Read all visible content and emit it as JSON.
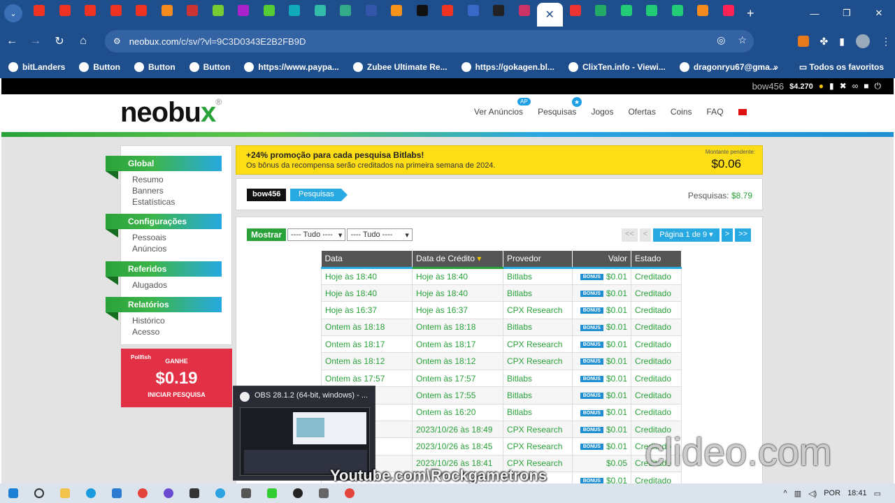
{
  "browser": {
    "tabs": [
      {
        "icon": "youtube-icon",
        "color": "#e32"
      },
      {
        "icon": "youtube-icon",
        "color": "#e32"
      },
      {
        "icon": "youtube-icon",
        "color": "#e32"
      },
      {
        "icon": "youtube-icon",
        "color": "#e32"
      },
      {
        "icon": "youtube-icon",
        "color": "#e32"
      },
      {
        "icon": "blogger-icon",
        "color": "#f58a1e"
      },
      {
        "icon": "app-icon",
        "color": "#c33"
      },
      {
        "icon": "vf-icon",
        "color": "#7c3"
      },
      {
        "icon": "app-icon",
        "color": "#a2c"
      },
      {
        "icon": "play-icon",
        "color": "#5c3"
      },
      {
        "icon": "c-icon",
        "color": "#1ab"
      },
      {
        "icon": "play-icon",
        "color": "#3ba"
      },
      {
        "icon": "globe-icon",
        "color": "#3a8"
      },
      {
        "icon": "c-icon",
        "color": "#35a"
      },
      {
        "icon": "bitcoin-icon",
        "color": "#f7931a"
      },
      {
        "icon": "tiktok-icon",
        "color": "#111"
      },
      {
        "icon": "youtube-icon",
        "color": "#e32"
      },
      {
        "icon": "download-icon",
        "color": "#3869c8"
      },
      {
        "icon": "r-icon",
        "color": "#222"
      },
      {
        "icon": "gear-icon",
        "color": "#c36"
      },
      {
        "icon": "close-icon",
        "color": "#fff",
        "active": true
      },
      {
        "icon": "app-icon",
        "color": "#e33"
      },
      {
        "icon": "app-icon",
        "color": "#2a6"
      },
      {
        "icon": "puzzle-icon",
        "color": "#2c7"
      },
      {
        "icon": "puzzle-icon",
        "color": "#2c7"
      },
      {
        "icon": "puzzle-icon",
        "color": "#2c7"
      },
      {
        "icon": "blogger-icon",
        "color": "#f58a1e"
      },
      {
        "icon": "blogger-icon",
        "color": "#f25"
      }
    ],
    "url_host": "neobux.com",
    "url_path": "/c/sv/?vl=9C3D0343E2B2FB9D",
    "bookmarks": [
      "bitLanders",
      "Button",
      "Button",
      "Button",
      "https://www.paypa...",
      "Zubee Ultimate Re...",
      "https://gokagen.bl...",
      "ClixTen.info - Viewi...",
      "dragonryu67@gma..."
    ],
    "bookmarks_more": "»",
    "all_bookmarks": "Todos os favoritos"
  },
  "site": {
    "user": "bow456",
    "balance": "$4.270",
    "logo_text": "neobu",
    "logo_x": "x",
    "logo_mark": "®",
    "nav": [
      {
        "label": "Ver Anúncios",
        "badge": "AP"
      },
      {
        "label": "Pesquisas",
        "badge": "★"
      },
      {
        "label": "Jogos"
      },
      {
        "label": "Ofertas"
      },
      {
        "label": "Coins"
      },
      {
        "label": "FAQ"
      }
    ]
  },
  "sidebar": {
    "sections": [
      {
        "title": "Global",
        "items": [
          "Resumo",
          "Banners",
          "Estatísticas"
        ]
      },
      {
        "title": "Configurações",
        "items": [
          "Pessoais",
          "Anúncios"
        ]
      },
      {
        "title": "Referidos",
        "items": [
          "Alugados"
        ]
      },
      {
        "title": "Relatórios",
        "items": [
          "Histórico",
          "Acesso"
        ]
      }
    ]
  },
  "pollfish": {
    "logo": "Pollfish",
    "earn": "GANHE",
    "amount": "$0.19",
    "cta": "INICIAR PESQUISA"
  },
  "promo": {
    "title": "+24% promoção para cada pesquisa Bitlabs!",
    "subtitle": "Os bônus da recompensa serão creditados na primeira semana de 2024.",
    "pending_label": "Montante pendente:",
    "pending_value": "$0.06"
  },
  "breadcrumb": {
    "user": "bow456",
    "page": "Pesquisas",
    "stat_label": "Pesquisas:",
    "stat_value": "$8.79"
  },
  "filters": {
    "show": "Mostrar",
    "filter1": "---- Tudo ----",
    "filter2": "---- Tudo ----"
  },
  "pager": {
    "first": "<<",
    "prev": "<",
    "page": "Página 1 de 9",
    "next": ">",
    "last": ">>"
  },
  "table": {
    "headers": [
      "Data",
      "Data de Crédito",
      "Provedor",
      "Valor",
      "Estado"
    ],
    "sort_indicator": "▾",
    "bonus_label": "BONUS",
    "rows": [
      {
        "date": "Hoje às 18:40",
        "credit": "Hoje às 18:40",
        "provider": "Bitlabs",
        "bonus": true,
        "value": "$0.01",
        "status": "Creditado"
      },
      {
        "date": "Hoje às 18:40",
        "credit": "Hoje às 18:40",
        "provider": "Bitlabs",
        "bonus": true,
        "value": "$0.01",
        "status": "Creditado"
      },
      {
        "date": "Hoje às 16:37",
        "credit": "Hoje às 16:37",
        "provider": "CPX Research",
        "bonus": true,
        "value": "$0.01",
        "status": "Creditado"
      },
      {
        "date": "Ontem às 18:18",
        "credit": "Ontem às 18:18",
        "provider": "Bitlabs",
        "bonus": true,
        "value": "$0.01",
        "status": "Creditado"
      },
      {
        "date": "Ontem às 18:17",
        "credit": "Ontem às 18:17",
        "provider": "CPX Research",
        "bonus": true,
        "value": "$0.01",
        "status": "Creditado"
      },
      {
        "date": "Ontem às 18:12",
        "credit": "Ontem às 18:12",
        "provider": "CPX Research",
        "bonus": true,
        "value": "$0.01",
        "status": "Creditado"
      },
      {
        "date": "Ontem às 17:57",
        "credit": "Ontem às 17:57",
        "provider": "Bitlabs",
        "bonus": true,
        "value": "$0.01",
        "status": "Creditado"
      },
      {
        "date": "55",
        "credit": "Ontem às 17:55",
        "provider": "Bitlabs",
        "bonus": true,
        "value": "$0.01",
        "status": "Creditado"
      },
      {
        "date": "20",
        "credit": "Ontem às 16:20",
        "provider": "Bitlabs",
        "bonus": true,
        "value": "$0.01",
        "status": "Creditado"
      },
      {
        "date": "18:49",
        "credit": "2023/10/26 às 18:49",
        "provider": "CPX Research",
        "bonus": true,
        "value": "$0.01",
        "status": "Creditado"
      },
      {
        "date": "18:45",
        "credit": "2023/10/26 às 18:45",
        "provider": "CPX Research",
        "bonus": true,
        "value": "$0.01",
        "status": "Creditado"
      },
      {
        "date": "18:41",
        "credit": "2023/10/26 às 18:41",
        "provider": "CPX Research",
        "bonus": false,
        "value": "$0.05",
        "status": "Creditado"
      },
      {
        "date": "",
        "credit": "",
        "provider": "",
        "bonus": true,
        "value": "$0.01",
        "status": "Creditado"
      }
    ]
  },
  "obs_popup": {
    "title": "OBS 28.1.2 (64-bit, windows) - ..."
  },
  "watermarks": {
    "youtube": "Youtube.com\\Rockgametrons",
    "clideo": "clideo.com"
  },
  "taskbar": {
    "language": "POR",
    "time": "18:41"
  }
}
